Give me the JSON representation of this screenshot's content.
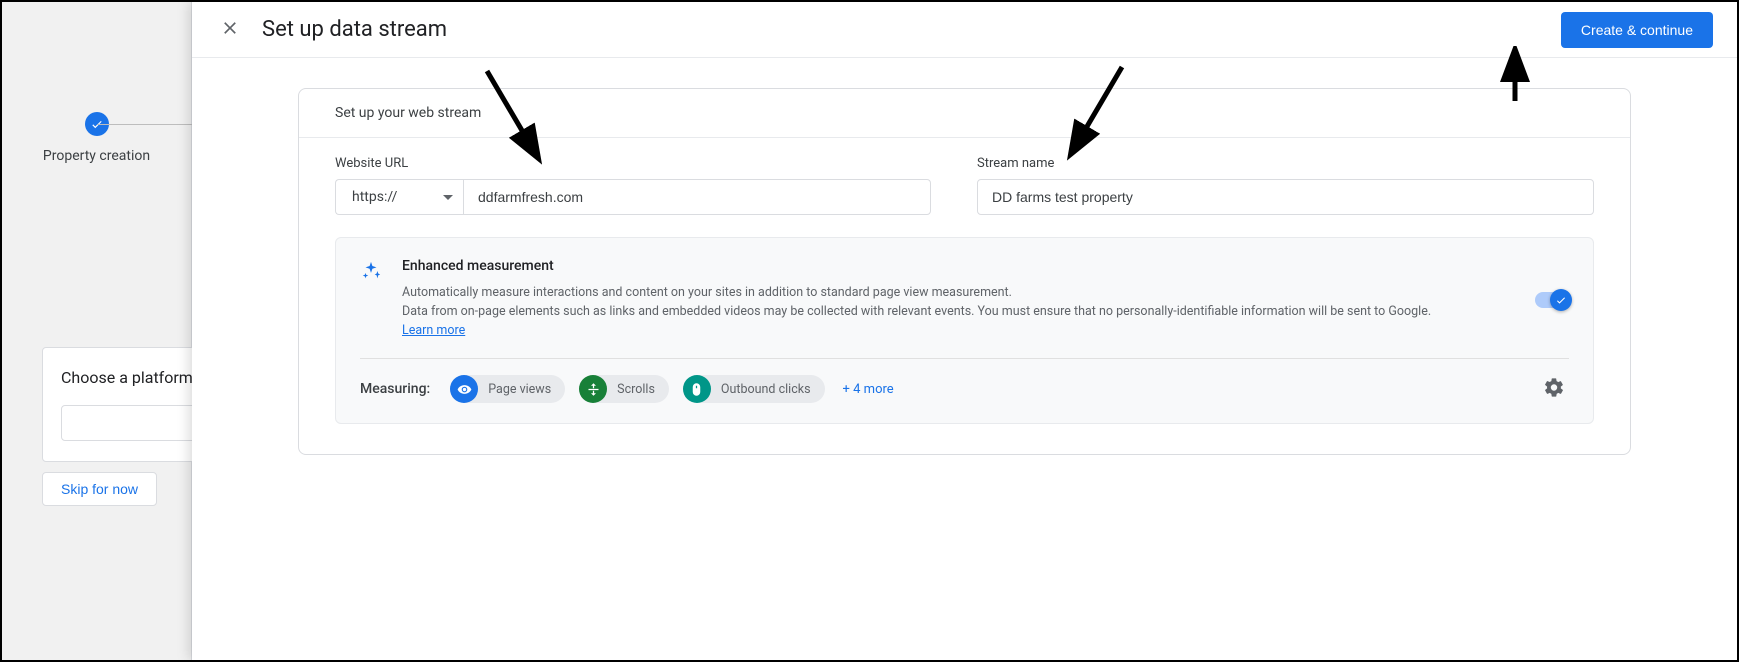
{
  "stepper": {
    "step1_label": "Property creation"
  },
  "background": {
    "choose_title": "Choose a platform",
    "skip_label": "Skip for now"
  },
  "header": {
    "title": "Set up data stream",
    "create_button": "Create & continue"
  },
  "card": {
    "section_title": "Set up your web stream",
    "url_label": "Website URL",
    "protocol": "https://",
    "url_value": "ddfarmfresh.com",
    "name_label": "Stream name",
    "name_value": "DD farms test property"
  },
  "enhanced": {
    "title": "Enhanced measurement",
    "desc_line1": "Automatically measure interactions and content on your sites in addition to standard page view measurement.",
    "desc_line2": "Data from on-page elements such as links and embedded videos may be collected with relevant events. You must ensure that no personally-identifiable information will be sent to Google.",
    "learn_more": "Learn more",
    "measuring_label": "Measuring:",
    "chips": {
      "page_views": "Page views",
      "scrolls": "Scrolls",
      "outbound": "Outbound clicks"
    },
    "more": "+ 4 more"
  }
}
